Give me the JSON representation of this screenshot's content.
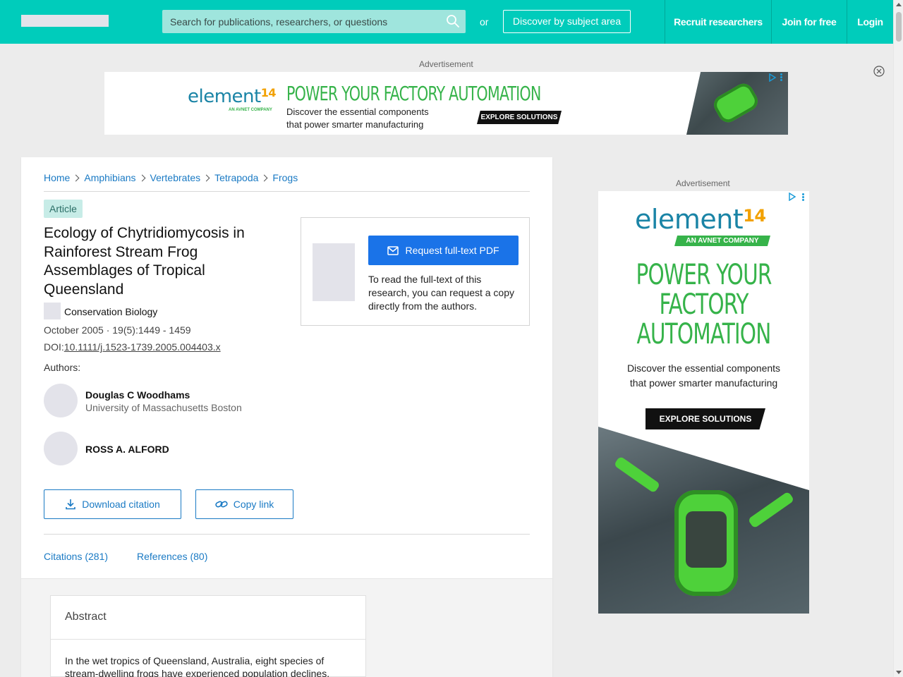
{
  "header": {
    "search_placeholder": "Search for publications, researchers, or questions",
    "or_text": "or",
    "discover_label": "Discover by subject area",
    "nav": [
      "Recruit researchers",
      "Join for free",
      "Login"
    ]
  },
  "ads": {
    "label": "Advertisement",
    "brand": "element",
    "brand_number": "14",
    "brand_tagline": "AN AVNET COMPANY",
    "headline": "POWER YOUR FACTORY AUTOMATION",
    "headline_lines": [
      "POWER YOUR",
      "FACTORY",
      "AUTOMATION"
    ],
    "subline_1": "Discover the essential components",
    "subline_2": "that power smarter manufacturing",
    "cta": "EXPLORE SOLUTIONS"
  },
  "breadcrumb": [
    "Home",
    "Amphibians",
    "Vertebrates",
    "Tetrapoda",
    "Frogs"
  ],
  "article": {
    "type_badge": "Article",
    "title": "Ecology of Chytridiomycosis in Rainforest Stream Frog Assemblages of Tropical Queensland",
    "journal": "Conservation Biology",
    "date_volume": "October 2005 · 19(5):1449 - 1459",
    "doi_label": "DOI:",
    "doi": "10.1111/j.1523-1739.2005.004403.x",
    "authors_label": "Authors:",
    "authors": [
      {
        "name": "Douglas C Woodhams",
        "affiliation": "University of Massachusetts Boston"
      },
      {
        "name": "ROSS A. ALFORD",
        "affiliation": ""
      }
    ],
    "download_citation": "Download citation",
    "copy_link": "Copy link"
  },
  "pdf_request": {
    "button": "Request full-text PDF",
    "text": "To read the full-text of this research, you can request a copy directly from the authors."
  },
  "tabs": [
    "Citations (281)",
    "References (80)"
  ],
  "abstract": {
    "title": "Abstract",
    "text": "In the wet tropics of Queensland, Australia, eight species of stream-dwelling frogs have experienced population declines."
  },
  "colors": {
    "header_bg": "#00ccbb",
    "link": "#1a7ac4",
    "primary_button": "#1a73e8",
    "ad_green": "#36b34a"
  }
}
